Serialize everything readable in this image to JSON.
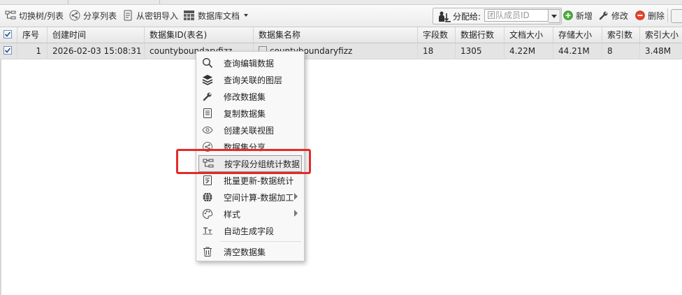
{
  "toolbar": {
    "switch_view_label": "切换树/列表",
    "share_list_label": "分享列表",
    "import_key_label": "从密钥导入",
    "db_docs_label": "数据库文档",
    "assign_label": "分配给:",
    "member_placeholder": "团队成员ID",
    "add_label": "新增",
    "edit_label": "修改",
    "delete_label": "删除"
  },
  "table": {
    "columns": [
      "序号",
      "创建时间",
      "数据集ID(表名)",
      "数据集名称",
      "字段数",
      "数据行数",
      "文档大小",
      "存储大小",
      "索引数",
      "索引大小"
    ],
    "rows": [
      {
        "seq": "1",
        "created": "2026-02-03 15:08:31",
        "dataset_id": "countyboundaryfizz",
        "dataset_name": "countyboundaryfizz",
        "fields": "18",
        "rows": "1305",
        "doc_size": "4.22M",
        "storage_size": "44.21M",
        "index_count": "8",
        "index_size": "3.48M"
      }
    ]
  },
  "context_menu": {
    "items": [
      {
        "label": "查询编辑数据",
        "icon": "search-icon"
      },
      {
        "label": "查询关联的图层",
        "icon": "layers-icon"
      },
      {
        "label": "修改数据集",
        "icon": "wrench-icon"
      },
      {
        "label": "复制数据集",
        "icon": "copy-doc-icon"
      },
      {
        "label": "创建关联视图",
        "icon": "eye-icon"
      },
      {
        "label": "数据集分享",
        "icon": "share-icon"
      },
      {
        "label": "按字段分组统计数据",
        "icon": "group-tree-icon"
      },
      {
        "label": "批量更新-数据统计",
        "icon": "edit-doc-icon"
      },
      {
        "label": "空间计算-数据加工",
        "icon": "globe-icon"
      },
      {
        "label": "样式",
        "icon": "palette-icon"
      },
      {
        "label": "自动生成字段",
        "icon": "text-field-icon"
      },
      {
        "label": "清空数据集",
        "icon": "trash-icon"
      }
    ]
  },
  "colors": {
    "highlight_box": "#e32a2a",
    "selected_row": "#e4e4e4"
  }
}
